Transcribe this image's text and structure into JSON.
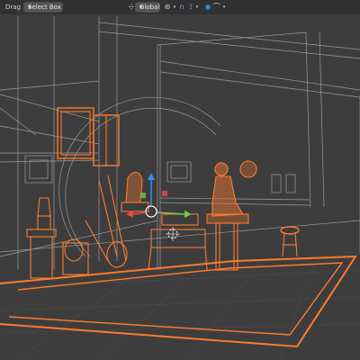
{
  "toolbar": {
    "drag_label": "Drag",
    "select_mode": "Select Box",
    "orientation": "Global"
  },
  "icons": {
    "drag": "cursor-icon",
    "orientation": "axes-icon",
    "pivot": "pivot-icon",
    "snap": "magnet-icon",
    "snap_target": "grid-icon",
    "proportional": "circle-dot-icon",
    "proportional_falloff": "falloff-curve-icon"
  },
  "colors": {
    "background": "#3d3d3d",
    "selection": "#ff7a2e",
    "wire": "#9a9a9a",
    "gizmo_z": "#3b8df2",
    "gizmo_x": "#f0474c",
    "gizmo_y": "#77c34c"
  }
}
